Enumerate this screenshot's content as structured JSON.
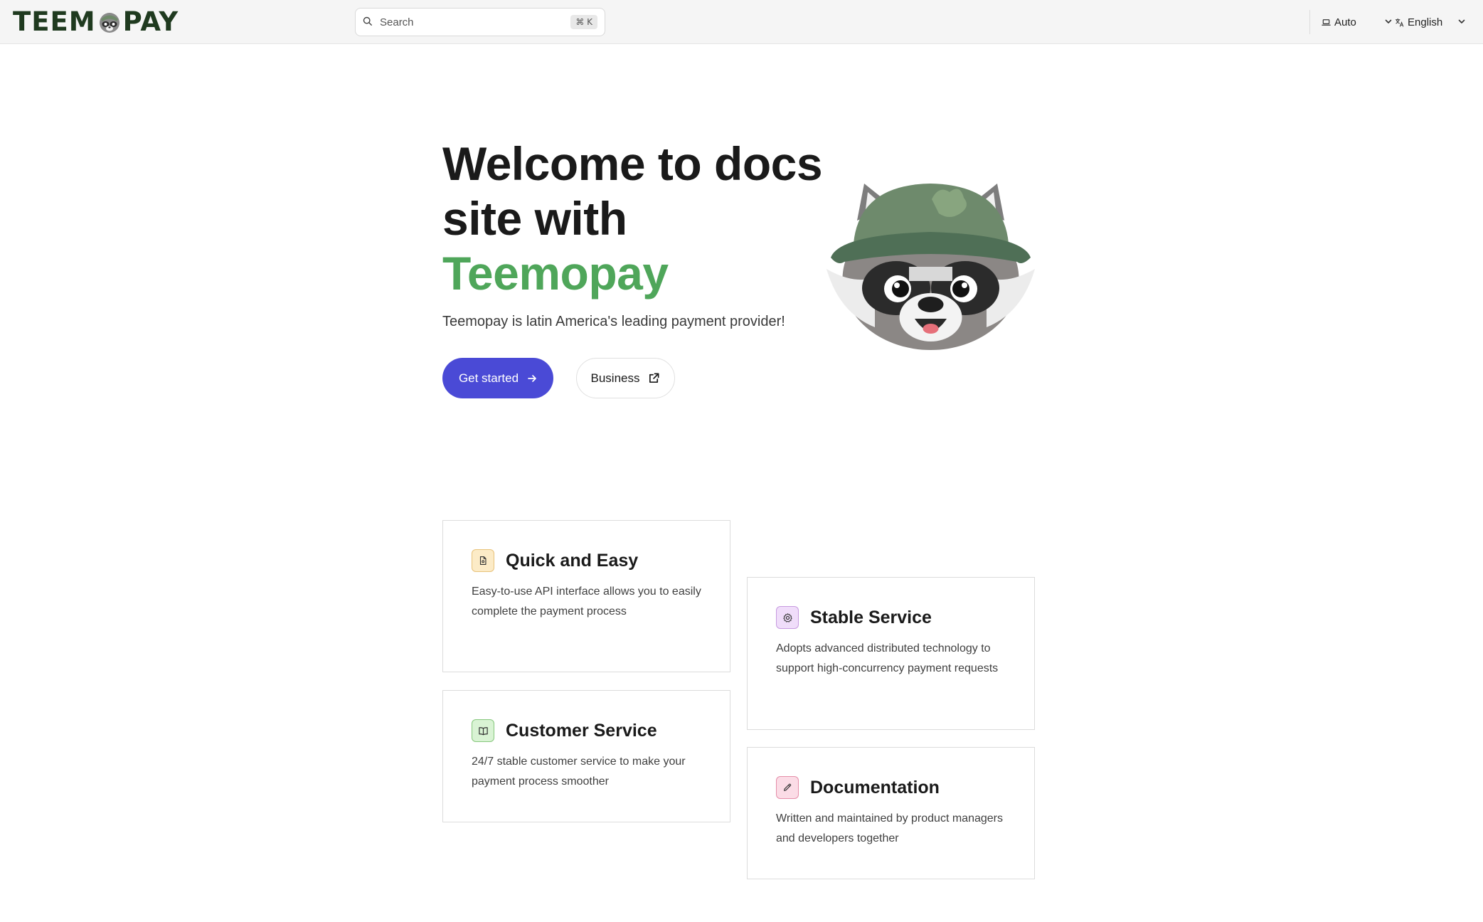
{
  "header": {
    "logo_text_left": "TEEM",
    "logo_text_right": "PAY",
    "search": {
      "placeholder": "Search",
      "shortcut": "⌘ K"
    },
    "theme_selector": {
      "label": "Auto"
    },
    "language_selector": {
      "label": "English"
    }
  },
  "hero": {
    "title_line1": "Welcome to docs",
    "title_line2": "site with",
    "title_brand": "Teemopay",
    "subtitle": "Teemopay is latin America's leading payment provider!",
    "primary_button": "Get started",
    "secondary_button": "Business"
  },
  "features": [
    {
      "title": "Quick and Easy",
      "description": "Easy-to-use API interface allows you to easily complete the payment process",
      "icon": "document-icon",
      "icon_bg": "#fcebc7",
      "icon_border": "#e8c27a"
    },
    {
      "title": "Stable Service",
      "description": "Adopts advanced distributed technology to support high-concurrency payment requests",
      "icon": "gear-icon",
      "icon_bg": "#f0ddfa",
      "icon_border": "#c79be0"
    },
    {
      "title": "Customer Service",
      "description": "24/7 stable customer service to make your payment process smoother",
      "icon": "book-icon",
      "icon_bg": "#d9f3d4",
      "icon_border": "#86c77c"
    },
    {
      "title": "Documentation",
      "description": "Written and maintained by product managers and developers together",
      "icon": "pencil-icon",
      "icon_bg": "#fbdce6",
      "icon_border": "#e58ea9"
    }
  ],
  "colors": {
    "brand_green": "#4fa65a",
    "primary_button": "#4a4ad6"
  }
}
